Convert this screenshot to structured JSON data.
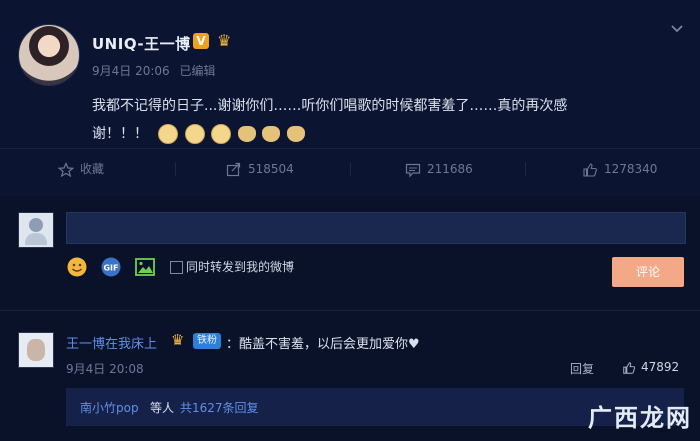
{
  "post": {
    "author": "UNIQ-王一博",
    "date": "9月4日 20:06",
    "edited": "已编辑",
    "text_line1": "我都不记得的日子...谢谢你们……听你们唱歌的时候都害羞了……真的再次感",
    "text_line2": "谢！！！"
  },
  "actions": {
    "favorite": "收藏",
    "repost": "518504",
    "comments": "211686",
    "likes": "1278340"
  },
  "composer": {
    "also_repost_label": "同时转发到我的微博",
    "submit_label": "评论"
  },
  "comment": {
    "user": "王一博在我床上",
    "tag": "铁粉",
    "text": "：酷盖不害羞，以后会更加爱你",
    "heart": "♥",
    "date": "9月4日 20:08",
    "reply_label": "回复",
    "likes": "47892"
  },
  "replies_bar": {
    "user": "南小竹pop",
    "mid": "等人",
    "count": "共1627条回复"
  },
  "watermark": {
    "text": "广西龙网"
  },
  "colors": {
    "background": "#0b1430",
    "link": "#5f8fe6",
    "button": "#f3a888",
    "crown": "#f5b43c"
  }
}
